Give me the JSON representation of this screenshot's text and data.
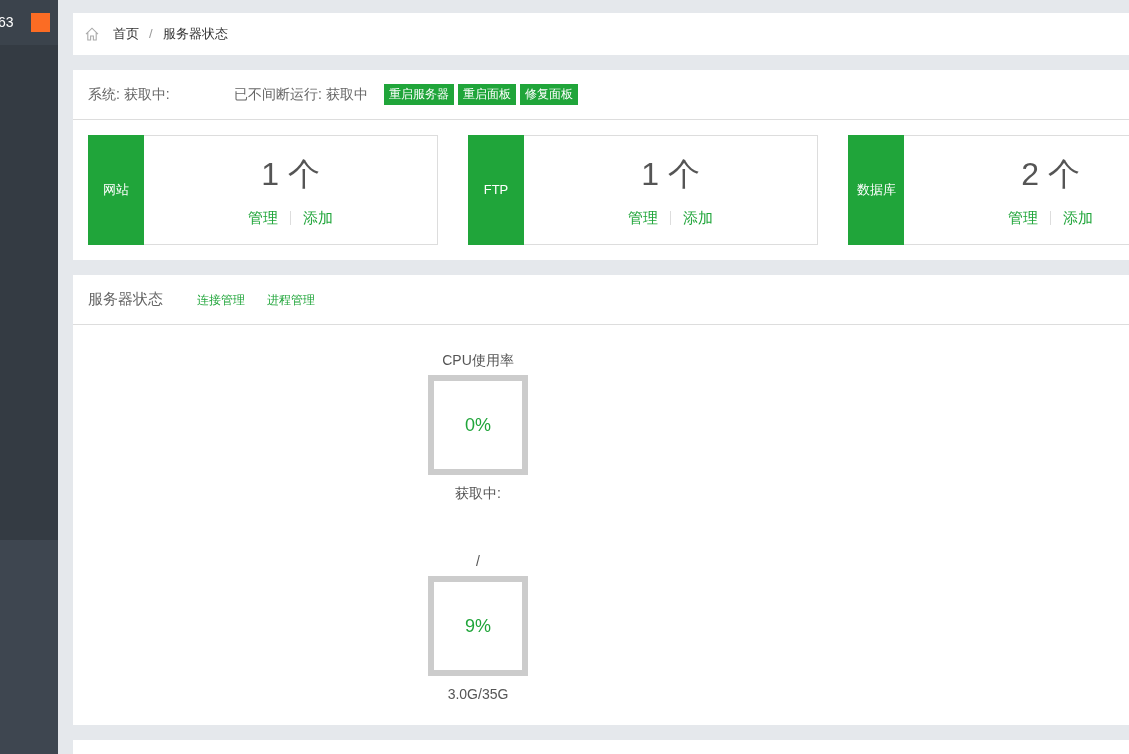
{
  "sidebar": {
    "text": "63"
  },
  "breadcrumb": {
    "items": [
      "首页",
      "服务器状态"
    ],
    "separator": "/"
  },
  "overview": {
    "system": "系统: 获取中:",
    "uptime": "已不间断运行: 获取中",
    "buttons": [
      "重启服务器",
      "重启面板",
      "修复面板"
    ],
    "stats": [
      {
        "label": "网站",
        "count": "1 个",
        "links": [
          "管理",
          "添加"
        ]
      },
      {
        "label": "FTP",
        "count": "1 个",
        "links": [
          "管理",
          "添加"
        ]
      },
      {
        "label": "数据库",
        "count": "2 个",
        "links": [
          "管理",
          "添加"
        ]
      }
    ]
  },
  "server_status": {
    "title": "服务器状态",
    "links": [
      "连接管理",
      "进程管理"
    ],
    "gauges": [
      {
        "title": "CPU使用率",
        "reading": "0%",
        "caption": "获取中:"
      },
      {
        "title": "/",
        "reading": "9%",
        "caption": "3.0G/35G"
      }
    ]
  }
}
